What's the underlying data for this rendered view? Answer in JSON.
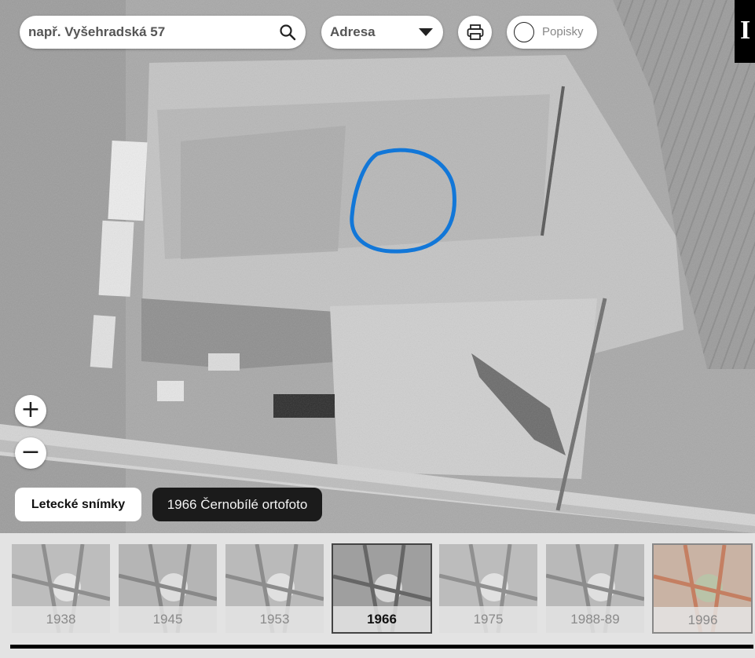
{
  "search": {
    "placeholder": "např. Vyšehradská 57",
    "icon": "search-icon"
  },
  "search_type": {
    "selected": "Adresa"
  },
  "print": {
    "icon": "printer-icon"
  },
  "labels_toggle": {
    "label": "Popisky",
    "checked": false
  },
  "info": {
    "label": "I"
  },
  "zoom": {
    "in_label": "+",
    "out_label": "−"
  },
  "layer": {
    "button_label": "Letecké snímky",
    "current_name": "1966 Černobílé ortofoto"
  },
  "timeline": {
    "years": [
      "1938",
      "1945",
      "1953",
      "1966",
      "1975",
      "1988-89",
      "1996"
    ],
    "selected": "1966"
  },
  "colors": {
    "highlight_circle": "#1277d8",
    "active_border": "#444444"
  }
}
